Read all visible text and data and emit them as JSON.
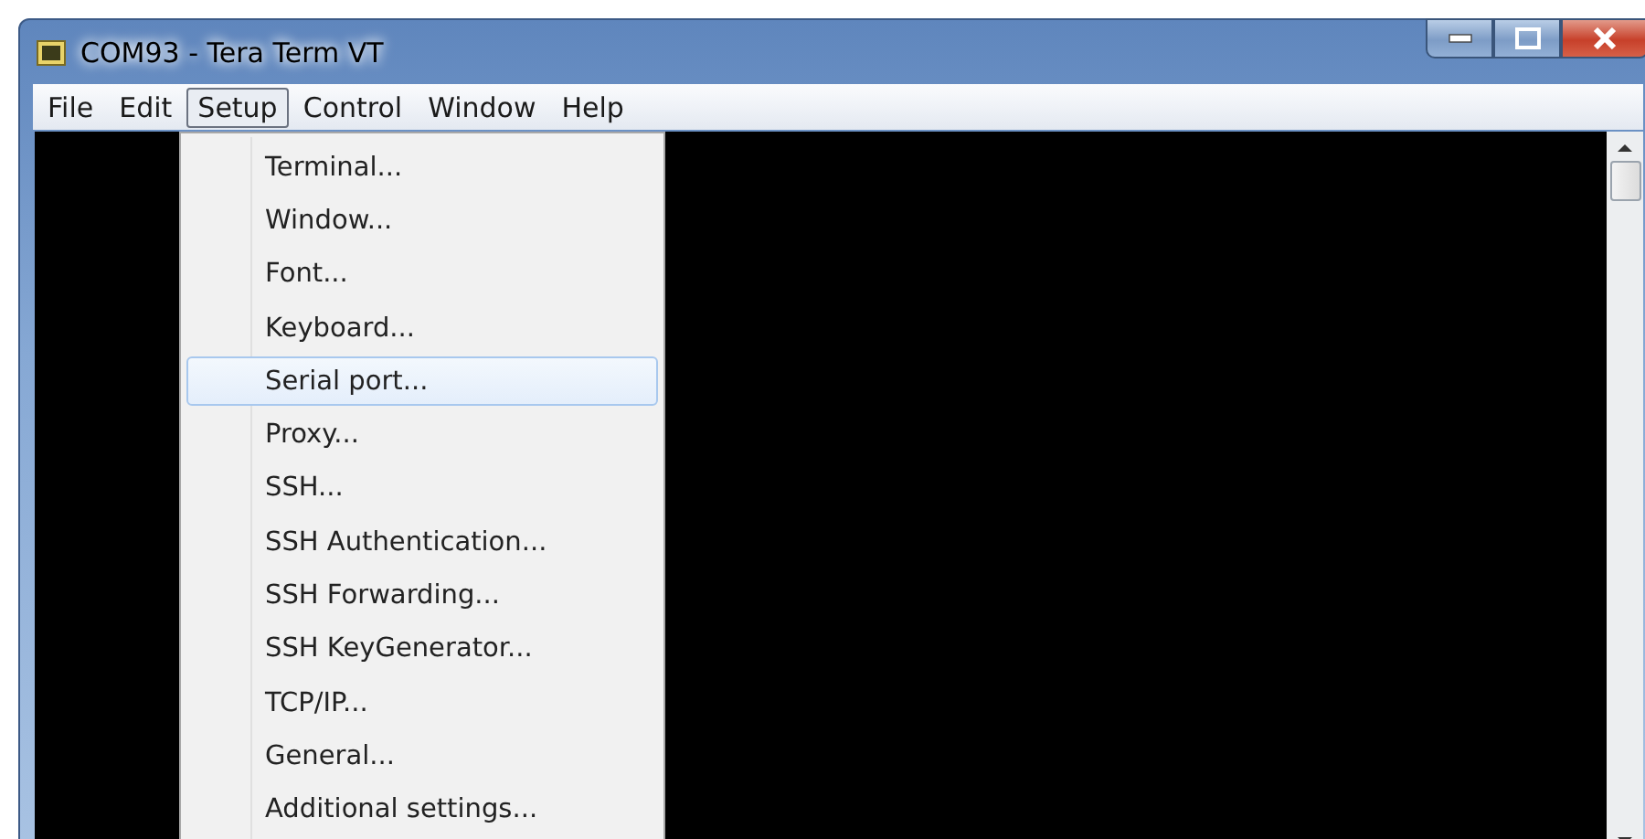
{
  "window": {
    "title": "COM93 - Tera Term VT"
  },
  "menu_bar": [
    {
      "label": "File",
      "selected": false
    },
    {
      "label": "Edit",
      "selected": false
    },
    {
      "label": "Setup",
      "selected": true
    },
    {
      "label": "Control",
      "selected": false
    },
    {
      "label": "Window",
      "selected": false
    },
    {
      "label": "Help",
      "selected": false
    }
  ],
  "dropdown": [
    {
      "label": "Terminal...",
      "selected": false
    },
    {
      "label": "Window...",
      "selected": false
    },
    {
      "label": "Font...",
      "selected": false
    },
    {
      "label": "Keyboard...",
      "selected": false
    },
    {
      "label": "Serial port...",
      "selected": true
    },
    {
      "label": "Proxy...",
      "selected": false
    },
    {
      "label": "SSH...",
      "selected": false
    },
    {
      "label": "SSH Authentication...",
      "selected": false
    },
    {
      "label": "SSH Forwarding...",
      "selected": false
    },
    {
      "label": "SSH KeyGenerator...",
      "selected": false
    },
    {
      "label": "TCP/IP...",
      "selected": false
    },
    {
      "label": "General...",
      "selected": false
    },
    {
      "label": "Additional settings...",
      "selected": false
    }
  ]
}
